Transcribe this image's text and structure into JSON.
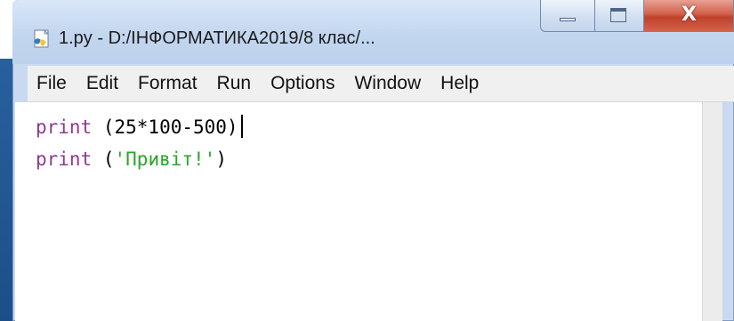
{
  "window": {
    "title": "1.py - D:/ІНФОРМАТИКА2019/8 клас/...",
    "close_glyph": "X"
  },
  "menu": {
    "items": [
      "File",
      "Edit",
      "Format",
      "Run",
      "Options",
      "Window",
      "Help"
    ]
  },
  "editor": {
    "lines": [
      {
        "keyword": "print",
        "rest": " (25*100-500)"
      },
      {
        "keyword": "print",
        "open": " (",
        "string": "'Привіт!'",
        "close": ")"
      }
    ]
  },
  "colors": {
    "keyword": "#8e3a8e",
    "string": "#2ca52c",
    "close_button": "#c0412b"
  }
}
